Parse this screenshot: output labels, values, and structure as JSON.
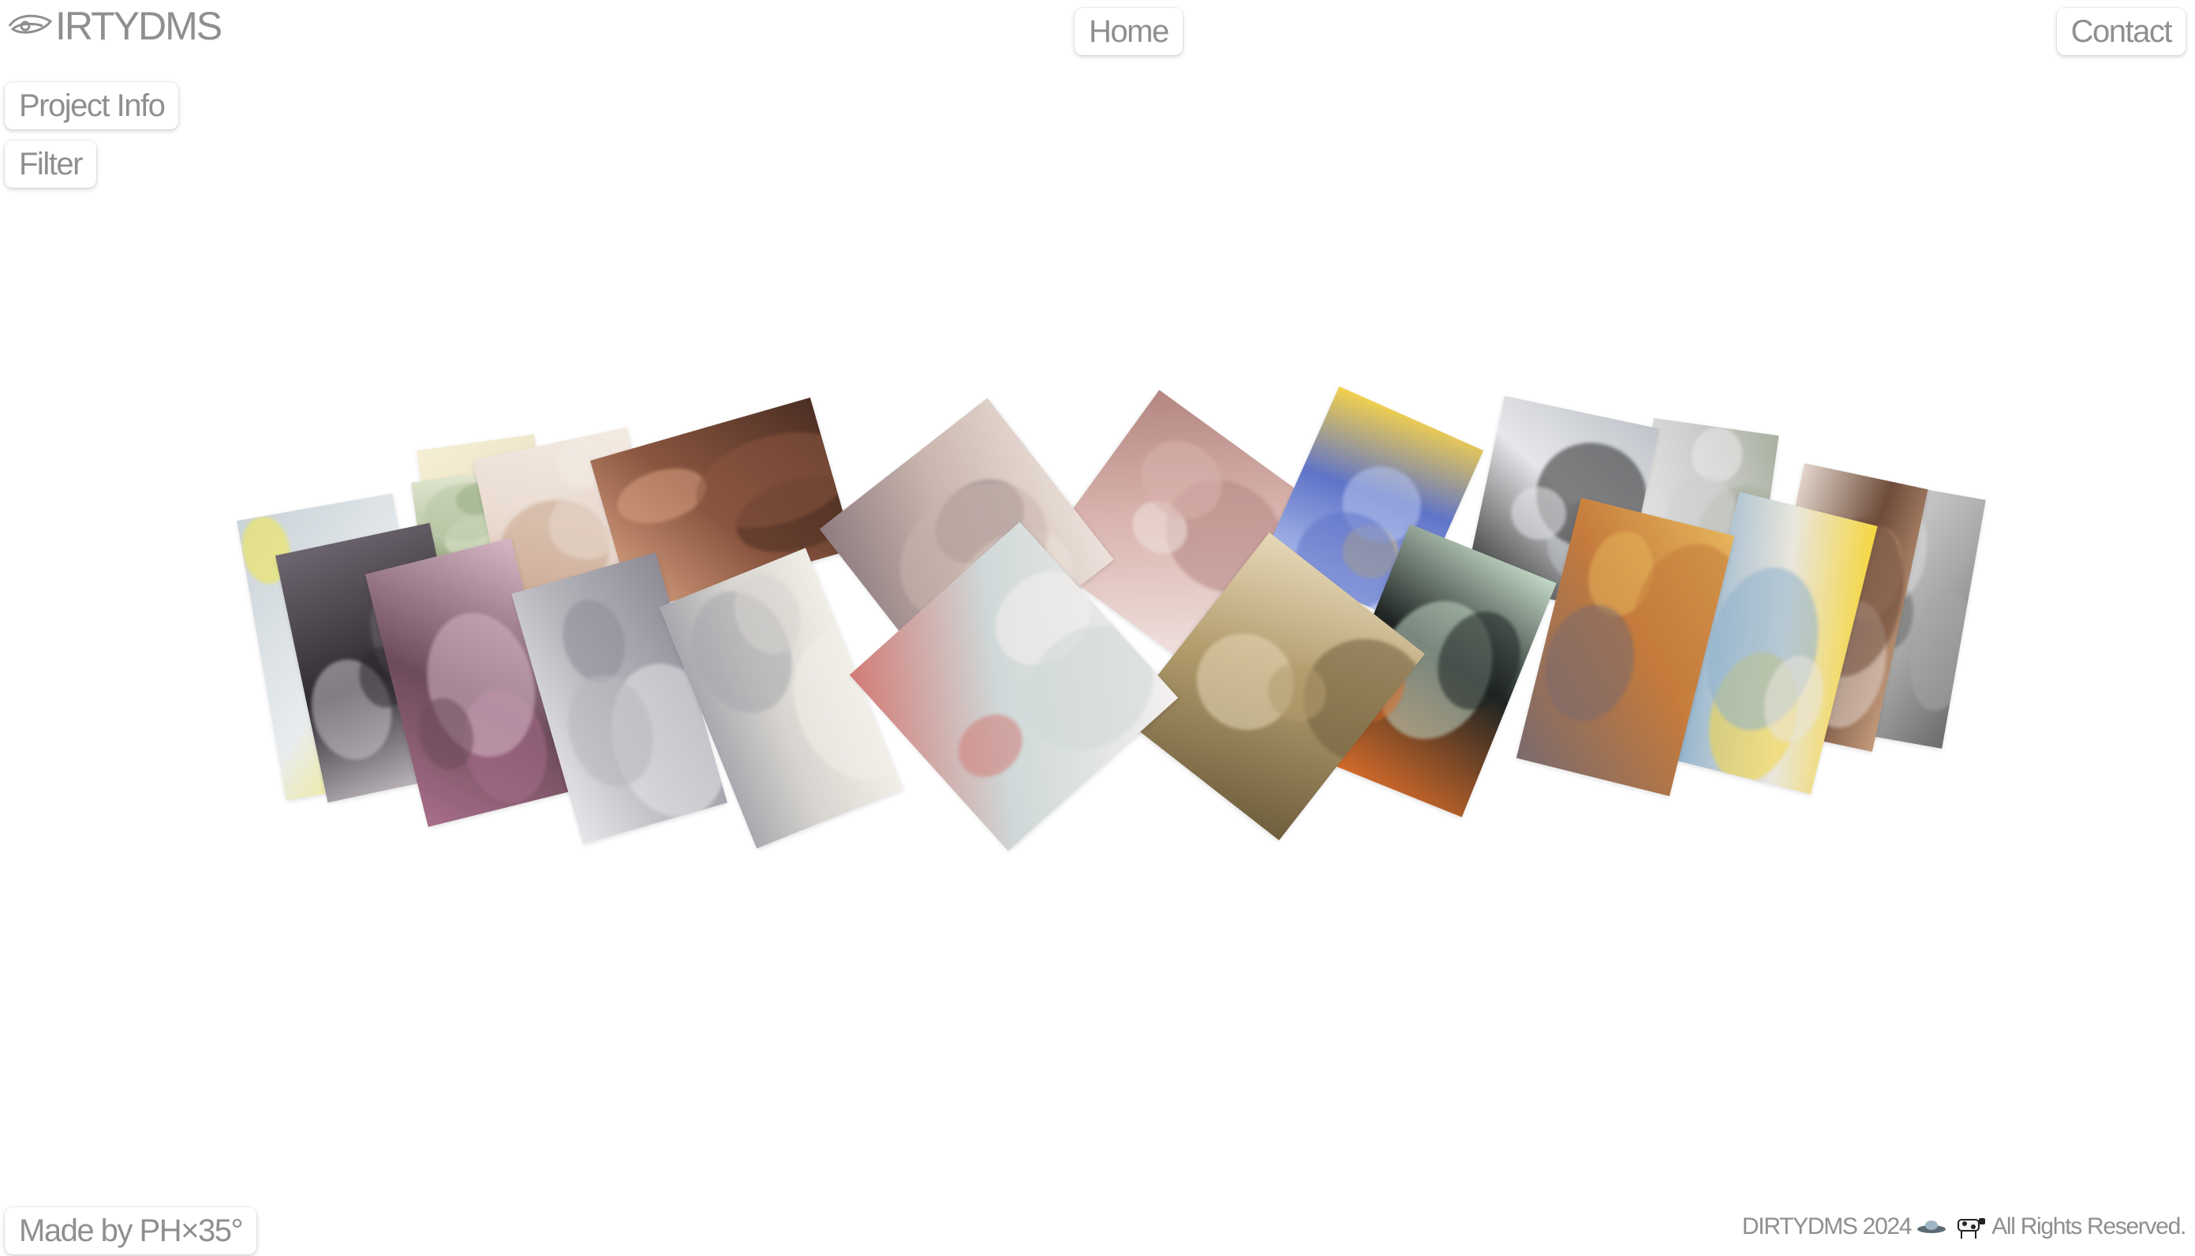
{
  "header": {
    "logo_text": "IRTYDMS",
    "logo_icon": "eye-lasso-icon",
    "nav_home": "Home",
    "nav_contact": "Contact"
  },
  "sidebar": {
    "project_info": "Project Info",
    "filter": "Filter"
  },
  "footer": {
    "made_by": "Made by PH×35°",
    "copyright_brand": "DIRTYDMS 2024",
    "copyright_icons": [
      "ufo-icon",
      "cow-icon"
    ],
    "rights": "All Rights Reserved."
  },
  "gallery": {
    "cards": [
      {
        "name": "artwork-01",
        "colors": [
          "#e9ecef",
          "#f4e94a",
          "#c9d3d8"
        ]
      },
      {
        "name": "artwork-02",
        "colors": [
          "#ece3c7",
          "#b8b6a1",
          "#f5efd3"
        ]
      },
      {
        "name": "artwork-03",
        "colors": [
          "#2e2a30",
          "#c9c3c8",
          "#6e6670"
        ]
      },
      {
        "name": "artwork-04",
        "colors": [
          "#b9c7a6",
          "#6f8c59",
          "#e4e9d4"
        ]
      },
      {
        "name": "artwork-05",
        "colors": [
          "#e9dacf",
          "#c8a58d",
          "#f3ebe3"
        ]
      },
      {
        "name": "artwork-06",
        "colors": [
          "#6c4b5a",
          "#a86e8a",
          "#d6b7c6"
        ]
      },
      {
        "name": "artwork-07",
        "colors": [
          "#8a5640",
          "#d9a383",
          "#4b2e23"
        ]
      },
      {
        "name": "artwork-08",
        "colors": [
          "#b8b7bd",
          "#e7e6ea",
          "#8d8a94"
        ]
      },
      {
        "name": "artwork-09",
        "colors": [
          "#d7d4cf",
          "#a6a7ad",
          "#f2efe9"
        ]
      },
      {
        "name": "artwork-10",
        "colors": [
          "#c9b5ad",
          "#8e7c80",
          "#ede2dc"
        ]
      },
      {
        "name": "artwork-11",
        "colors": [
          "#cfd8d8",
          "#d27b76",
          "#f4f1ef"
        ]
      },
      {
        "name": "artwork-12",
        "colors": [
          "#d9b3ad",
          "#b48681",
          "#f1e4e1"
        ]
      },
      {
        "name": "artwork-13",
        "colors": [
          "#b39d6e",
          "#e6d8b8",
          "#6f5e3d"
        ]
      },
      {
        "name": "artwork-14",
        "colors": [
          "#5f74c9",
          "#f4d14c",
          "#b9c6ef"
        ]
      },
      {
        "name": "artwork-15",
        "colors": [
          "#1e2423",
          "#c3d9c7",
          "#d96d2a"
        ]
      },
      {
        "name": "artwork-16",
        "colors": [
          "#e6e7ea",
          "#bfc3c9",
          "#2a2a2a"
        ]
      },
      {
        "name": "artwork-17",
        "colors": [
          "#c47a3c",
          "#e7b45b",
          "#7a6a6d"
        ]
      },
      {
        "name": "artwork-18",
        "colors": [
          "#cfcfcf",
          "#a9b09f",
          "#ebebeb"
        ]
      },
      {
        "name": "artwork-19",
        "colors": [
          "#e9e6dd",
          "#f6d63e",
          "#8fb1cc"
        ]
      },
      {
        "name": "artwork-20",
        "colors": [
          "#6e4c3a",
          "#c49a7b",
          "#e3d6cc"
        ]
      },
      {
        "name": "artwork-21",
        "colors": [
          "#a8a8a8",
          "#6b6b6b",
          "#d9d9d9"
        ]
      }
    ]
  }
}
